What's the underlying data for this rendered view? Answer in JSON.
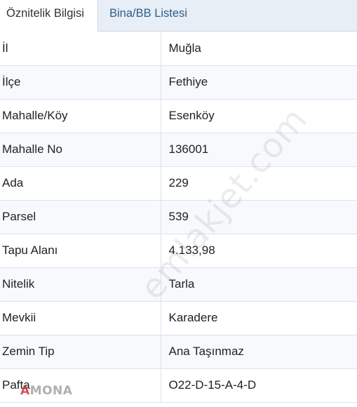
{
  "tabs": {
    "active_label": "Öznitelik Bilgisi",
    "inactive_label": "Bina/BB Listesi"
  },
  "rows": [
    {
      "label": "İl",
      "value": "Muğla"
    },
    {
      "label": "İlçe",
      "value": "Fethiye"
    },
    {
      "label": "Mahalle/Köy",
      "value": "Esenköy"
    },
    {
      "label": "Mahalle No",
      "value": "136001"
    },
    {
      "label": "Ada",
      "value": "229"
    },
    {
      "label": "Parsel",
      "value": "539"
    },
    {
      "label": "Tapu Alanı",
      "value": "4.133,98"
    },
    {
      "label": "Nitelik",
      "value": "Tarla"
    },
    {
      "label": "Mevkii",
      "value": "Karadere"
    },
    {
      "label": "Zemin Tip",
      "value": "Ana Taşınmaz"
    },
    {
      "label": "Pafta",
      "value": "O22-D-15-A-4-D"
    }
  ],
  "watermark": "emlakjet.com",
  "logo": {
    "mark": "A",
    "text": "MONA"
  },
  "colors": {
    "tabbar_bg": "#e8eef5",
    "inactive_tab_text": "#2d5f8a",
    "row_border": "#d9e3ee"
  }
}
